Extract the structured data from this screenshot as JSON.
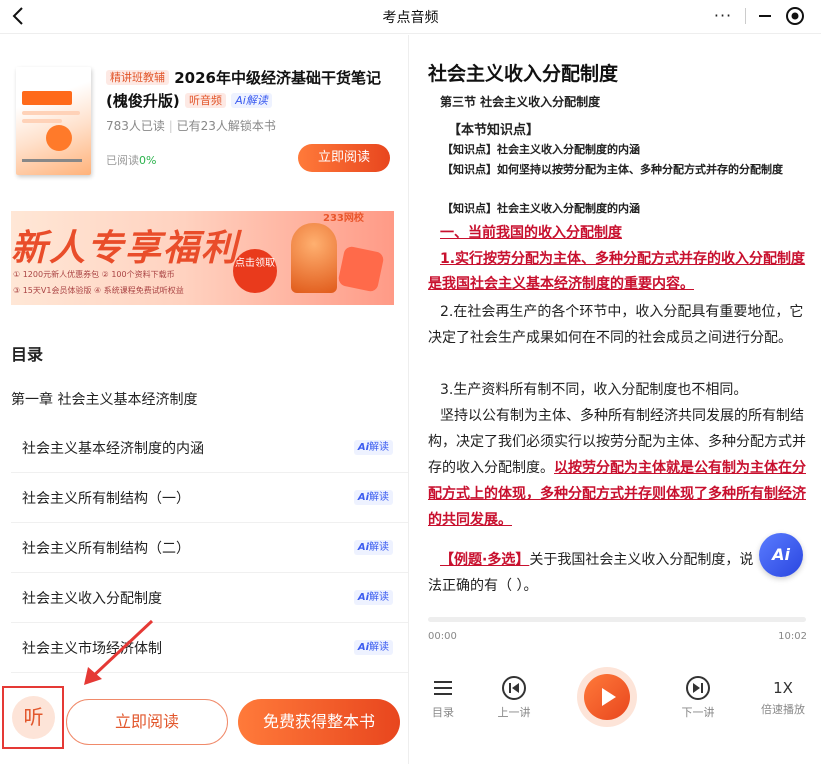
{
  "header": {
    "title": "考点音频",
    "more_icon": "···"
  },
  "book": {
    "tag_fine": "精讲班教辅",
    "title": "2026年中级经济基础干货笔记(槐俊升版)",
    "tag_audio": "听音频",
    "tag_ai": "Ai解读",
    "read_count": "783人已读",
    "unlock_count": "已有23人解锁本书",
    "progress_label": "已阅读",
    "progress_value": "0%",
    "read_button": "立即阅读"
  },
  "banner": {
    "headline": "新人专享福利",
    "logo": "233网校",
    "line1": "① 1200元新人优惠券包  ② 100个资料下载币",
    "line2": "③ 15天V1会员体验版  ④ 系统课程免费试听权益",
    "cta": "点击领取"
  },
  "toc": {
    "title": "目录",
    "chapter": "第一章 社会主义基本经济制度",
    "items": [
      {
        "label": "社会主义基本经济制度的内涵",
        "ai": "解读"
      },
      {
        "label": "社会主义所有制结构（一）",
        "ai": "解读"
      },
      {
        "label": "社会主义所有制结构（二）",
        "ai": "解读"
      },
      {
        "label": "社会主义收入分配制度",
        "ai": "解读"
      },
      {
        "label": "社会主义市场经济体制",
        "ai": "解读"
      }
    ]
  },
  "bottom": {
    "listen": "听",
    "read": "立即阅读",
    "free": "免费获得整本书"
  },
  "article": {
    "title": "社会主义收入分配制度",
    "section": "第三节 社会主义收入分配制度",
    "kp_header": "【本节知识点】",
    "kp1": "【知识点】社会主义收入分配制度的内涵",
    "kp2": "【知识点】如何坚持以按劳分配为主体、多种分配方式并存的分配制度",
    "kp3": "【知识点】社会主义收入分配制度的内涵",
    "h1": "一、当前我国的收入分配制度",
    "p1": "1.实行按劳分配为主体、多种分配方式并存的收入分配制度 是我国社会主义基本经济制度的重要内容。",
    "p2": "2.在社会再生产的各个环节中，收入分配具有重要地位，它决定了社会生产成果如何在不同的社会成员之间进行分配。",
    "p3": "3.生产资料所有制不同，收入分配制度也不相同。",
    "p4a": "坚持以公有制为主体、多种所有制经济共同发展的所有制结构，决定了我们必须实行以按劳分配为主体、多种分配方式并存的收入分配制度。",
    "p4b": "以按劳分配为主体就是公有制为主体在分配方式上的体现，多种分配方式并存则体现了多种所有制经济的共同发展。",
    "ex_tag": "【例题·多选】",
    "ex_text": "关于我国社会主义收入分配制度，说法正确的有（   ）。"
  },
  "player": {
    "current": "00:00",
    "total": "10:02",
    "progress": 0,
    "toc": "目录",
    "prev": "上一讲",
    "next": "下一讲",
    "speed": "1X",
    "speed_label": "倍速播放"
  },
  "colors": {
    "accent": "#e8461e",
    "highlight": "#c8102e",
    "ai": "#3a5bf0"
  }
}
